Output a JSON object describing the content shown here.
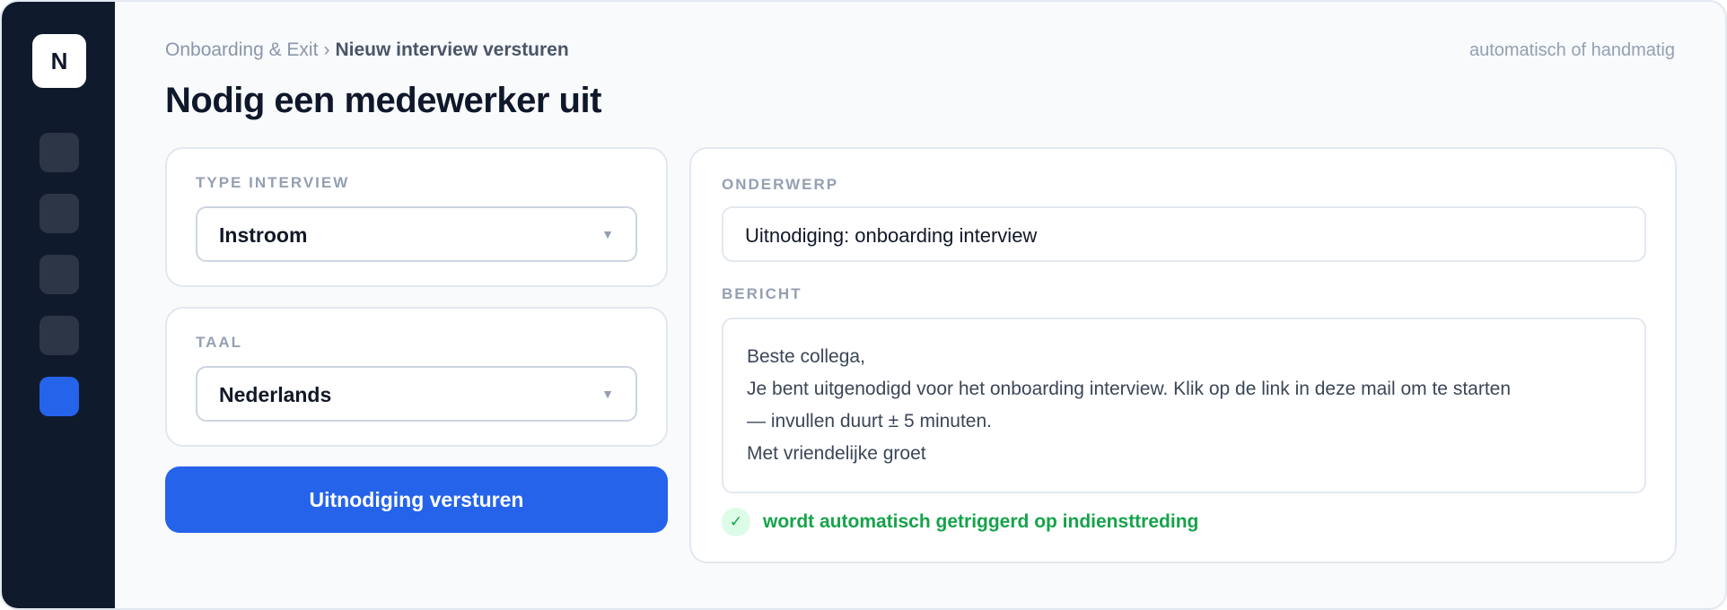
{
  "sidebar": {
    "logo_letter": "N",
    "items": [
      {
        "icon": "nav-icon",
        "active": false
      },
      {
        "icon": "nav-icon",
        "active": false
      },
      {
        "icon": "nav-icon",
        "active": false
      },
      {
        "icon": "nav-icon",
        "active": false
      },
      {
        "icon": "nav-icon",
        "active": true
      }
    ]
  },
  "header": {
    "breadcrumb_parent": "Onboarding & Exit",
    "breadcrumb_separator": "›",
    "breadcrumb_current": "Nieuw interview versturen",
    "mode_hint": "automatisch of handmatig",
    "title": "Nodig een medewerker uit"
  },
  "form": {
    "interview_type": {
      "label": "Type interview",
      "value": "Instroom"
    },
    "language": {
      "label": "Taal",
      "value": "Nederlands"
    },
    "caret_glyph": "▼",
    "send_label": "Uitnodiging versturen"
  },
  "message": {
    "subject_label": "Onderwerp",
    "subject_value": "Uitnodiging: onboarding interview",
    "body_label": "Bericht",
    "body_lines": [
      "Beste collega,",
      "Je bent uitgenodigd voor het onboarding interview. Klik op de link in deze mail om te starten",
      "— invullen duurt ± 5 minuten.",
      "Met vriendelijke groet"
    ],
    "status_icon": "check-icon",
    "status_glyph": "✓",
    "status_text": "wordt automatisch getriggerd op indiensttreding"
  },
  "colors": {
    "sidebar_bg": "#0f1b2d",
    "accent": "#2563eb",
    "success": "#16a34a"
  }
}
